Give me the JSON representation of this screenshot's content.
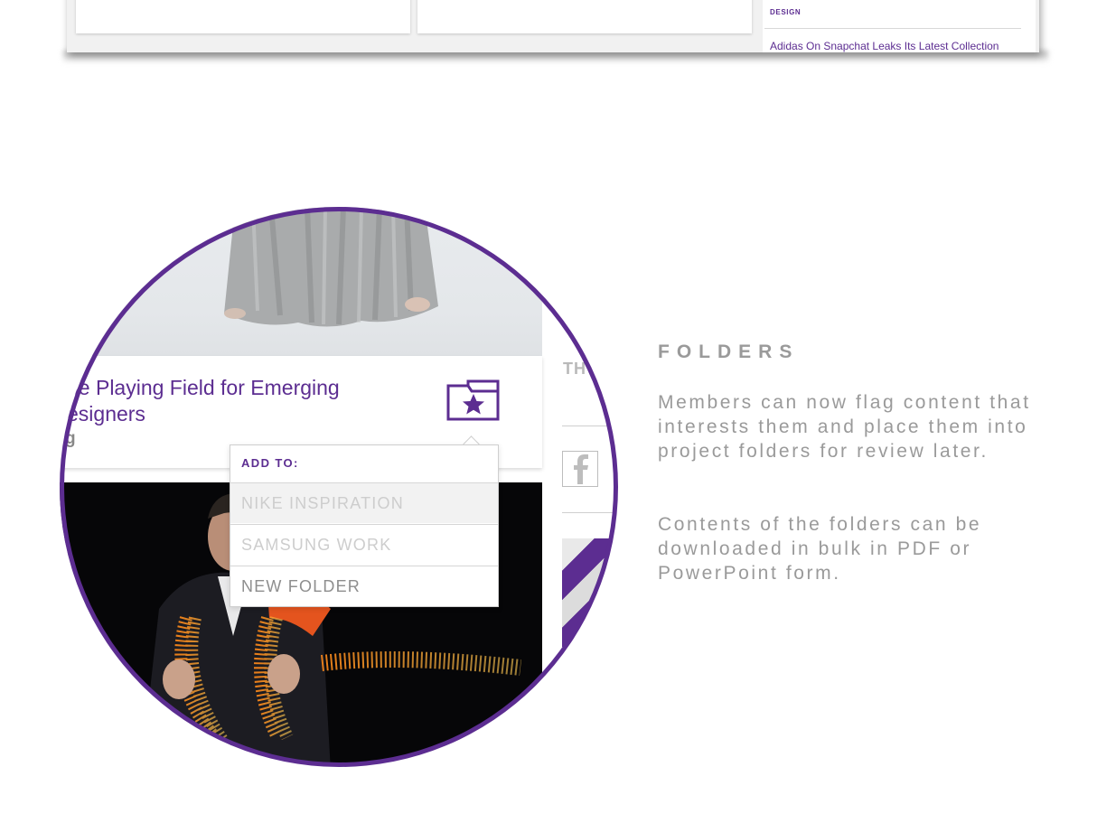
{
  "top_strip": {
    "category": "DESIGN",
    "link": "Adidas On Snapchat Leaks Its Latest Collection"
  },
  "card": {
    "title": "he Playing Field for Emerging designers",
    "title_line1": "he Playing Field for Emerging",
    "title_line2": "esigners",
    "sub": "g",
    "folder_icon": "folder-star-icon"
  },
  "side": {
    "label": "TH",
    "social_icon": "facebook-icon"
  },
  "dropdown": {
    "heading": "ADD TO:",
    "items": [
      {
        "label": "NIKE INSPIRATION"
      },
      {
        "label": "SAMSUNG WORK"
      },
      {
        "label": "NEW FOLDER"
      }
    ]
  },
  "description": {
    "title": "FOLDERS",
    "paragraph1": "Members can now flag content that interests them and place them into project folders for review later.",
    "paragraph2": "Contents of the folders can be downloaded in bulk in PDF or PowerPoint form."
  },
  "colors": {
    "accent": "#5c2d91",
    "muted_text": "#9a9a9a"
  }
}
